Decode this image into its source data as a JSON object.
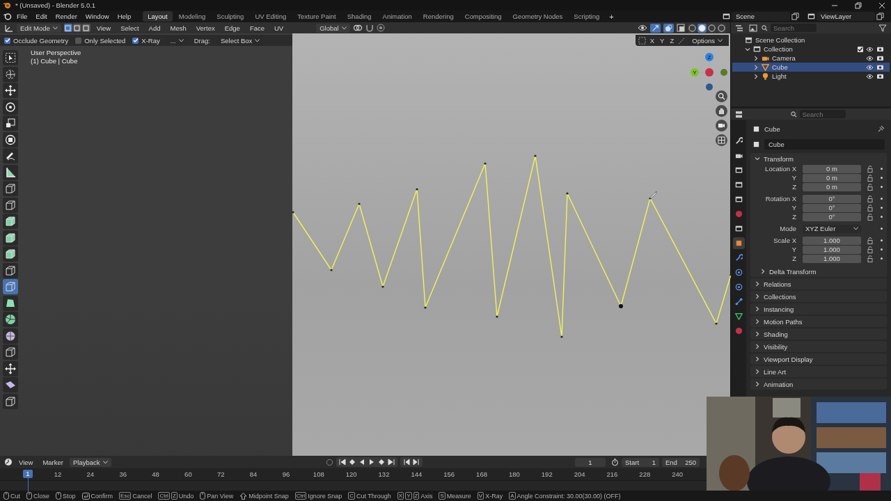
{
  "title_bar": {
    "title": "* (Unsaved) - Blender 5.0.1"
  },
  "menu": [
    "File",
    "Edit",
    "Render",
    "Window",
    "Help"
  ],
  "workspaces": [
    {
      "label": "Layout",
      "selected": true
    },
    {
      "label": "Modeling",
      "selected": false
    },
    {
      "label": "Sculpting",
      "selected": false
    },
    {
      "label": "UV Editing",
      "selected": false
    },
    {
      "label": "Texture Paint",
      "selected": false
    },
    {
      "label": "Shading",
      "selected": false
    },
    {
      "label": "Animation",
      "selected": false
    },
    {
      "label": "Rendering",
      "selected": false
    },
    {
      "label": "Compositing",
      "selected": false
    },
    {
      "label": "Geometry Nodes",
      "selected": false
    },
    {
      "label": "Scripting",
      "selected": false
    }
  ],
  "add_workspace": "+",
  "scene": {
    "name": "Scene"
  },
  "view_layer": {
    "name": "ViewLayer"
  },
  "viewport": {
    "mode": "Edit Mode",
    "select_modes": [
      {
        "selected": true
      },
      {
        "selected": false
      },
      {
        "selected": false
      }
    ],
    "menus": [
      "View",
      "Select",
      "Add",
      "Mesh",
      "Vertex",
      "Edge",
      "Face",
      "UV"
    ],
    "orientation": "Global",
    "shading": [
      {
        "selected": false
      },
      {
        "selected": true
      },
      {
        "selected": false
      },
      {
        "selected": false
      }
    ],
    "tool_settings": [
      {
        "label": "Occlude Geometry",
        "checked": true
      },
      {
        "label": "Only Selected",
        "checked": false
      },
      {
        "label": "X-Ray",
        "checked": true
      }
    ],
    "more": "...",
    "drag_label": "Drag:",
    "drag_value": "Select Box",
    "axes": [
      "X",
      "Y",
      "Z"
    ],
    "options": "Options",
    "info": [
      "User Perspective",
      "(1) Cube | Cube"
    ],
    "gizmo_labels": [
      "Z",
      "Y"
    ],
    "tools": [
      {
        "kind": "select",
        "selected": false
      },
      {
        "kind": "cursor",
        "selected": false
      },
      {
        "kind": "move",
        "selected": false
      },
      {
        "kind": "rotate",
        "selected": false
      },
      {
        "kind": "scale",
        "selected": false
      },
      {
        "kind": "transform",
        "selected": false
      },
      {
        "kind": "annotate",
        "selected": false
      },
      {
        "kind": "measure",
        "selected": false
      },
      {
        "kind": "cube",
        "selected": false
      },
      {
        "kind": "cube",
        "selected": false
      },
      {
        "kind": "cube-green",
        "selected": false
      },
      {
        "kind": "cube-green",
        "selected": false
      },
      {
        "kind": "cube-green",
        "selected": false
      },
      {
        "kind": "cube",
        "selected": false
      },
      {
        "kind": "cube",
        "selected": true
      },
      {
        "kind": "polygon",
        "selected": false
      },
      {
        "kind": "spin",
        "selected": false
      },
      {
        "kind": "sphere",
        "selected": false
      },
      {
        "kind": "cube",
        "selected": false
      },
      {
        "kind": "move",
        "selected": false
      },
      {
        "kind": "slab",
        "selected": false
      },
      {
        "kind": "cube",
        "selected": false
      }
    ]
  },
  "outliner": {
    "search": {
      "placeholder": "Search"
    },
    "tree": [
      {
        "label": "Scene Collection",
        "kind": "scene",
        "children": [
          {
            "label": "Collection",
            "kind": "collection",
            "expanded": true,
            "checked": true,
            "children": [
              {
                "label": "Camera",
                "kind": "camera",
                "expanded": false,
                "selected": false
              },
              {
                "label": "Cube",
                "kind": "mesh",
                "expanded": false,
                "selected": true
              },
              {
                "label": "Light",
                "kind": "light",
                "expanded": false,
                "selected": false
              }
            ]
          }
        ]
      }
    ]
  },
  "properties": {
    "search": {
      "placeholder": "Search"
    },
    "tabs": [
      {
        "kind": "tool",
        "selected": false
      },
      {
        "kind": "render",
        "selected": false
      },
      {
        "kind": "output",
        "selected": false
      },
      {
        "kind": "view",
        "selected": false
      },
      {
        "kind": "scene",
        "selected": false
      },
      {
        "kind": "world",
        "selected": false
      },
      {
        "kind": "collection",
        "selected": false
      },
      {
        "kind": "object",
        "selected": true
      },
      {
        "kind": "modifier",
        "selected": false
      },
      {
        "kind": "particles",
        "selected": false
      },
      {
        "kind": "physics",
        "selected": false
      },
      {
        "kind": "constraints",
        "selected": false
      },
      {
        "kind": "data",
        "selected": false
      },
      {
        "kind": "material",
        "selected": false
      }
    ],
    "object": "Cube",
    "data_name": "Cube",
    "transform": {
      "title": "Transform",
      "expanded": true,
      "groups": [
        [
          {
            "label": "Location X",
            "value": "0 m",
            "kind": "number"
          },
          {
            "label": "Y",
            "value": "0 m",
            "kind": "number"
          },
          {
            "label": "Z",
            "value": "0 m",
            "kind": "number"
          }
        ],
        [
          {
            "label": "Rotation X",
            "value": "0°",
            "kind": "number"
          },
          {
            "label": "Y",
            "value": "0°",
            "kind": "number"
          },
          {
            "label": "Z",
            "value": "0°",
            "kind": "number"
          }
        ],
        [
          {
            "label": "Mode",
            "value": "XYZ Euler",
            "kind": "dropdown"
          }
        ],
        [
          {
            "label": "Scale X",
            "value": "1.000",
            "kind": "number"
          },
          {
            "label": "Y",
            "value": "1.000",
            "kind": "number"
          },
          {
            "label": "Z",
            "value": "1.000",
            "kind": "number"
          }
        ]
      ],
      "subpanel": {
        "title": "Delta Transform",
        "expanded": false
      }
    },
    "panels": [
      {
        "title": "Relations",
        "expanded": false
      },
      {
        "title": "Collections",
        "expanded": false
      },
      {
        "title": "Instancing",
        "expanded": false
      },
      {
        "title": "Motion Paths",
        "expanded": false
      },
      {
        "title": "Shading",
        "expanded": false
      },
      {
        "title": "Visibility",
        "expanded": false
      },
      {
        "title": "Viewport Display",
        "expanded": false
      },
      {
        "title": "Line Art",
        "expanded": false
      },
      {
        "title": "Animation",
        "expanded": false
      }
    ]
  },
  "timeline": {
    "menus": [
      "View",
      "Marker"
    ],
    "playback": "Playback",
    "marker": "1",
    "current_frame": "1",
    "start_label": "Start",
    "start": "1",
    "end_label": "End",
    "end": "250",
    "ticks": [
      "12",
      "24",
      "36",
      "48",
      "60",
      "72",
      "84",
      "96",
      "108",
      "120",
      "132",
      "144",
      "156",
      "168",
      "180",
      "192",
      "204",
      "216",
      "228",
      "240"
    ]
  },
  "status_bar": {
    "items": [
      {
        "kind": "mouse",
        "label": "Cut"
      },
      {
        "kind": "mouse",
        "label": "Close"
      },
      {
        "kind": "mouse",
        "label": "Stop"
      },
      {
        "kind": "enter",
        "label": "Confirm"
      },
      {
        "kind": "keys",
        "keys": [
          "Esc"
        ],
        "label": "Cancel"
      },
      {
        "kind": "keys",
        "keys": [
          "Ctrl",
          "Z"
        ],
        "label": "Undo"
      },
      {
        "kind": "mouse",
        "label": "Pan View"
      },
      {
        "kind": "shift",
        "label": "Midpoint Snap"
      },
      {
        "kind": "keys",
        "keys": [
          "Ctrl"
        ],
        "label": "Ignore Snap"
      },
      {
        "kind": "keys",
        "keys": [
          "C"
        ],
        "label": "Cut Through"
      },
      {
        "kind": "keys",
        "keys": [
          "X",
          "Y",
          "Z"
        ],
        "label": "Axis"
      },
      {
        "kind": "keys",
        "keys": [
          "S"
        ],
        "label": "Measure"
      },
      {
        "kind": "keys",
        "keys": [
          "V"
        ],
        "label": "X-Ray"
      },
      {
        "kind": "keys",
        "keys": [
          "A"
        ],
        "label": "Angle Constraint: 30.00(30.00) (OFF)"
      }
    ]
  }
}
